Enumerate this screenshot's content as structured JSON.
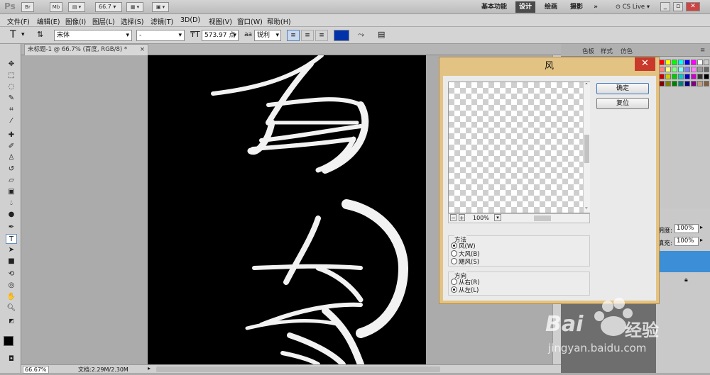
{
  "appbar": {
    "logo": "Ps",
    "br": "Br",
    "mb": "Mb",
    "zoom": "66.7",
    "workspaces": [
      "基本功能",
      "设计",
      "绘画",
      "摄影"
    ],
    "active_workspace": "设计",
    "more": "»",
    "cslive": "CS Live"
  },
  "menu": [
    "文件(F)",
    "编辑(E)",
    "图像(I)",
    "图层(L)",
    "选择(S)",
    "滤镜(T)",
    "3D(D)",
    "视图(V)",
    "窗口(W)",
    "帮助(H)"
  ],
  "options": {
    "tool": "T",
    "font_family": "宋体",
    "font_style": "-",
    "font_size": "573.97 点",
    "aa_label": "aa",
    "antialias": "锐利",
    "color_hex": "#0033aa"
  },
  "document": {
    "tab_title": "未标题-1 @ 66.7% (百度, RGB/8) *",
    "zoom": "66.67%",
    "doc_info": "文档:2.29M/2.30M"
  },
  "dialog": {
    "title": "风",
    "ok": "确定",
    "reset": "复位",
    "preview_zoom": "100%",
    "method_title": "方法",
    "methods": [
      "风(W)",
      "大风(B)",
      "飓风(S)"
    ],
    "method_selected": 0,
    "direction_title": "方向",
    "directions": [
      "从右(R)",
      "从左(L)"
    ],
    "direction_selected": 1
  },
  "panels": {
    "tabs": [
      "色板",
      "样式",
      "仿色"
    ],
    "opacity_label": "明度:",
    "opacity_value": "100%",
    "fill_label": "填充:",
    "fill_value": "100%"
  },
  "watermark": {
    "brand": "Bai",
    "brand2": "经验",
    "url": "jingyan.baidu.com"
  },
  "colors": {
    "accent": "#3c8ed6",
    "dialog_frame": "#e3c383",
    "close_red": "#c8392b"
  }
}
